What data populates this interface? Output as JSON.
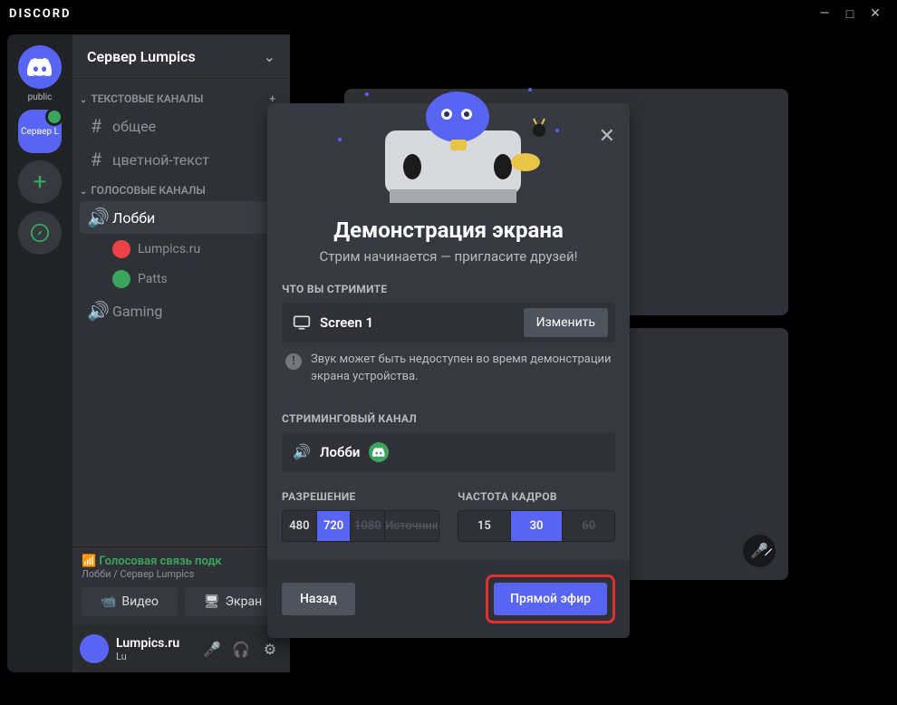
{
  "titlebar": {
    "logo": "DISCORD"
  },
  "servers": {
    "home_label": "public",
    "add_icon": "+",
    "server2_label": "Сервер L"
  },
  "sidebar": {
    "server_name": "Сервер Lumpics",
    "text_category": "ТЕКСТОВЫЕ КАНАЛЫ",
    "voice_category": "ГОЛОСОВЫЕ КАНАЛЫ",
    "text_channels": [
      "общее",
      "цветной-текст"
    ],
    "voice_channels": [
      {
        "name": "Лобби",
        "members": [
          "Lumpics.ru",
          "Patts"
        ]
      },
      {
        "name": "Gaming",
        "members": []
      }
    ],
    "voice_status": "Голосовая связь подк",
    "voice_sub": "Лобби / Сервер Lumpics",
    "btn_video": "Видео",
    "btn_screen": "Экран",
    "user": {
      "name": "Lumpics.ru",
      "tag": "Lu"
    }
  },
  "modal": {
    "title": "Демонстрация экрана",
    "subtitle": "Стрим начинается — пригласите друзей!",
    "sec_stream": "ЧТО ВЫ СТРИМИТЕ",
    "stream_source": "Screen 1",
    "change": "Изменить",
    "warn": "Звук может быть недоступен во время демонстрации экрана устройства.",
    "sec_channel": "СТРИМИНГОВЫЙ КАНАЛ",
    "channel": "Лобби",
    "sec_res": "РАЗРЕШЕНИЕ",
    "sec_fps": "ЧАСТОТА КАДРОВ",
    "res_opts": [
      "480",
      "720",
      "1080",
      "Источник"
    ],
    "res_active": "720",
    "res_disabled": [
      "1080",
      "Источник"
    ],
    "fps_opts": [
      "15",
      "30",
      "60"
    ],
    "fps_active": "30",
    "fps_disabled": [
      "60"
    ],
    "btn_back": "Назад",
    "btn_live": "Прямой эфир"
  }
}
